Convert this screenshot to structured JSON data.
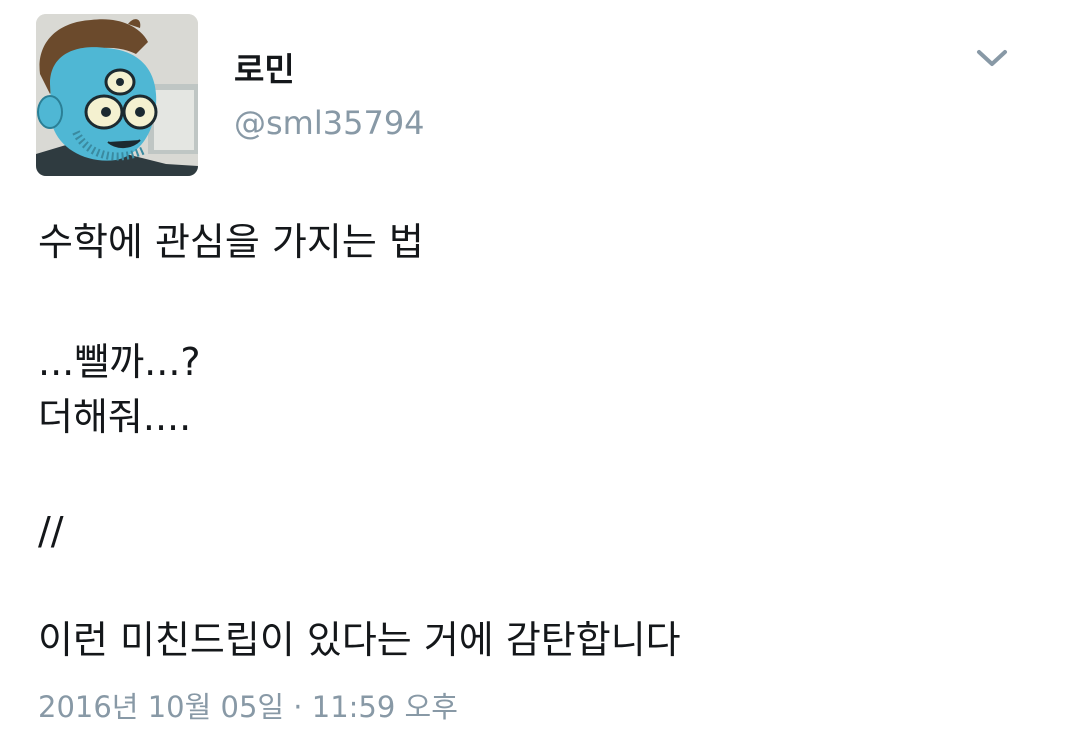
{
  "user": {
    "display_name": "로민",
    "handle": "@sml35794"
  },
  "tweet": {
    "lines": [
      "수학에 관심을 가지는 법",
      "...뺄까...?",
      "더해줘....",
      "//",
      "이런 미친드립이 있다는 거에 감탄합니다"
    ],
    "timestamp": "2016년 10월 05일 · 11:59 오후"
  },
  "icons": {
    "menu": "chevron-down-icon",
    "avatar": "cartoon-character-avatar"
  },
  "colors": {
    "text": "#14171a",
    "secondary": "#8899a6",
    "background": "#ffffff",
    "avatar_skin": "#4fb7d4"
  }
}
